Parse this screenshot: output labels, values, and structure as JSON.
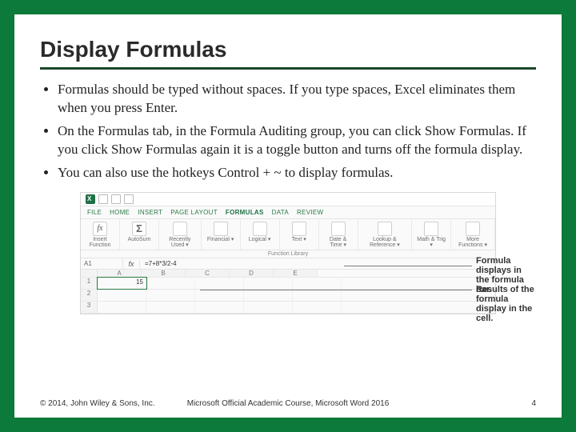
{
  "slide": {
    "title": "Display Formulas",
    "bullets": [
      "Formulas should be typed without spaces.  If you type spaces, Excel eliminates them when you press Enter.",
      " On the Formulas tab, in the Formula Auditing group, you can click Show Formulas.  If you click Show Formulas again it is a toggle button and turns off the formula display.",
      "You can also use the hotkeys Control + ~ to display formulas."
    ]
  },
  "ribbon": {
    "tabs": {
      "file": "FILE",
      "home": "HOME",
      "insert": "INSERT",
      "pagelayout": "PAGE LAYOUT",
      "formulas": "FORMULAS",
      "data": "DATA",
      "review": "REVIEW"
    },
    "groups": {
      "insertfn": "Insert\nFunction",
      "autosum": "AutoSum",
      "recent": "Recently\nUsed ▾",
      "financial": "Financial\n▾",
      "logical": "Logical\n▾",
      "text": "Text\n▾",
      "datetime": "Date &\nTime ▾",
      "lookup": "Lookup &\nReference ▾",
      "math": "Math &\nTrig ▾",
      "more": "More\nFunctions ▾"
    },
    "libcaption": "Function Library"
  },
  "sheet": {
    "namebox": "A1",
    "fx": "fx",
    "formula": "=7+8*3/2-4",
    "cols": [
      "A",
      "B",
      "C",
      "D",
      "E"
    ],
    "rows": [
      "1",
      "2",
      "3"
    ],
    "a1": "15"
  },
  "callouts": {
    "fbar": "Formula displays in\nthe formula bar.",
    "cell": "Results of the formula\ndisplay in the cell."
  },
  "footer": {
    "left": "© 2014, John Wiley & Sons, Inc.",
    "center": "Microsoft Official Academic Course, Microsoft Word 2016",
    "right": "4"
  }
}
